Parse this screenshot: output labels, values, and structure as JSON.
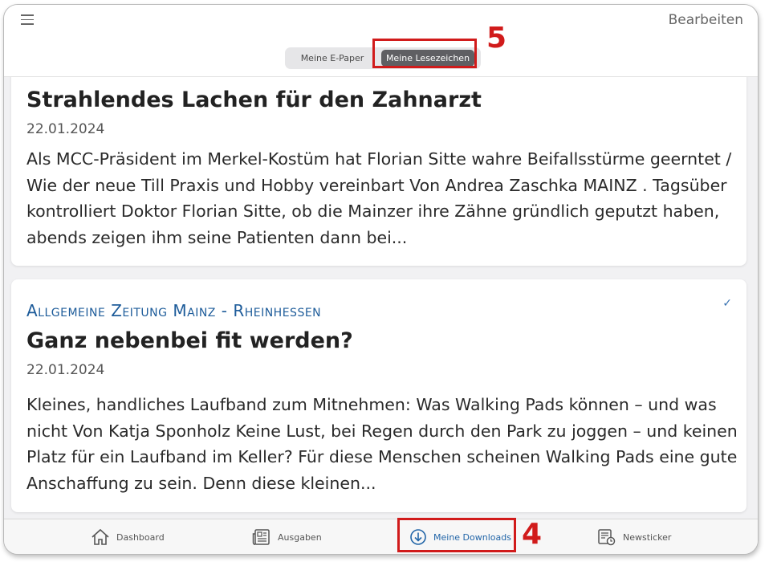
{
  "header": {
    "edit_label": "Bearbeiten",
    "segments": [
      "Meine E-Paper",
      "Meine Lesezeichen"
    ]
  },
  "annotations": {
    "top": "5",
    "bottom": "4"
  },
  "articles": [
    {
      "title": "Strahlendes Lachen für den Zahnarzt",
      "date": "22.01.2024",
      "excerpt": "Als MCC-Präsident im Merkel-Kostüm hat Florian Sitte wahre Beifallsstürme geerntet / Wie der neue Till Praxis und Hobby vereinbart Von Andrea Zaschka MAINZ . Tagsüber kontrolliert Doktor Florian Sitte, ob die Mainzer ihre Zähne gründlich geputzt haben, abends zeigen ihm seine Patienten dann bei..."
    },
    {
      "source": "Allgemeine Zeitung Mainz - Rheinhessen",
      "title": "Ganz nebenbei fit werden?",
      "date": "22.01.2024",
      "excerpt": "Kleines, handliches Laufband zum Mitnehmen: Was Walking Pads können – und was nicht Von Katja Sponholz Keine Lust, bei Regen durch den Park zu joggen – und keinen Platz für ein Laufband im Keller? Für diese Menschen scheinen Walking Pads eine gute Anschaffung zu sein. Denn diese kleinen..."
    }
  ],
  "tabbar": {
    "items": [
      {
        "label": "Dashboard",
        "icon": "home-icon"
      },
      {
        "label": "Ausgaben",
        "icon": "newspaper-icon"
      },
      {
        "label": "Meine Downloads",
        "icon": "download-icon"
      },
      {
        "label": "Newsticker",
        "icon": "newsticker-icon"
      }
    ],
    "active_color": "#2366a8"
  }
}
